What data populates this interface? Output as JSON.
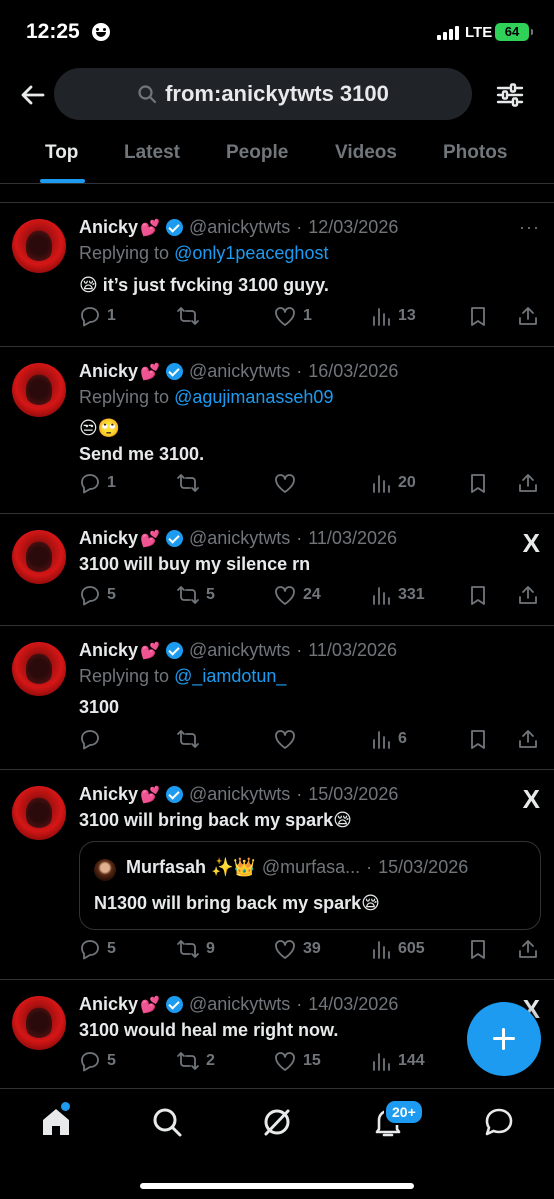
{
  "status_bar": {
    "time": "12:25",
    "network": "LTE",
    "battery": "64"
  },
  "search": {
    "query": "from:anickytwts 3100"
  },
  "tabs": [
    {
      "label": "Top",
      "active": true
    },
    {
      "label": "Latest",
      "active": false
    },
    {
      "label": "People",
      "active": false
    },
    {
      "label": "Videos",
      "active": false
    },
    {
      "label": "Photos",
      "active": false
    }
  ],
  "tweets": [
    {
      "name": "Anicky",
      "name_emoji": "💕",
      "handle": "@anickytwts",
      "date": "12/03/2026",
      "reply_prefix": "Replying to",
      "reply_to": "@only1peaceghost",
      "text_lines": [
        "😪 it’s just fvcking 3100 guyy."
      ],
      "replies": "1",
      "reposts": "",
      "likes": "1",
      "views": "13"
    },
    {
      "name": "Anicky",
      "name_emoji": "💕",
      "handle": "@anickytwts",
      "date": "16/03/2026",
      "reply_prefix": "Replying to",
      "reply_to": "@agujimanasseh09",
      "text_lines": [
        "😒🙄",
        "Send me 3100."
      ],
      "replies": "1",
      "reposts": "",
      "likes": "",
      "views": "20"
    },
    {
      "name": "Anicky",
      "name_emoji": "💕",
      "handle": "@anickytwts",
      "date": "11/03/2026",
      "source_icon": "X",
      "text_lines": [
        "3100 will buy my silence rn"
      ],
      "replies": "5",
      "reposts": "5",
      "likes": "24",
      "views": "331"
    },
    {
      "name": "Anicky",
      "name_emoji": "💕",
      "handle": "@anickytwts",
      "date": "11/03/2026",
      "reply_prefix": "Replying to",
      "reply_to": "@_iamdotun_",
      "text_lines": [
        "3100"
      ],
      "replies": "",
      "reposts": "",
      "likes": "",
      "views": "6"
    },
    {
      "name": "Anicky",
      "name_emoji": "💕",
      "handle": "@anickytwts",
      "date": "15/03/2026",
      "source_icon": "X",
      "text_lines": [
        "3100 will bring back my spark😪"
      ],
      "quote": {
        "name": "Murfasah ✨👑",
        "handle": "@murfasa...",
        "date": "15/03/2026",
        "text": "N1300 will bring back my spark😪"
      },
      "replies": "5",
      "reposts": "9",
      "likes": "39",
      "views": "605"
    },
    {
      "name": "Anicky",
      "name_emoji": "💕",
      "handle": "@anickytwts",
      "date": "14/03/2026",
      "source_icon": "X",
      "text_lines": [
        "3100 would heal me right now."
      ],
      "replies": "5",
      "reposts": "2",
      "likes": "15",
      "views": "144"
    }
  ],
  "bottom_nav": {
    "notifications_badge": "20+"
  },
  "colors": {
    "accent": "#1d9bf0",
    "background": "#000000",
    "muted": "#71767b",
    "text": "#e7e9ea"
  }
}
